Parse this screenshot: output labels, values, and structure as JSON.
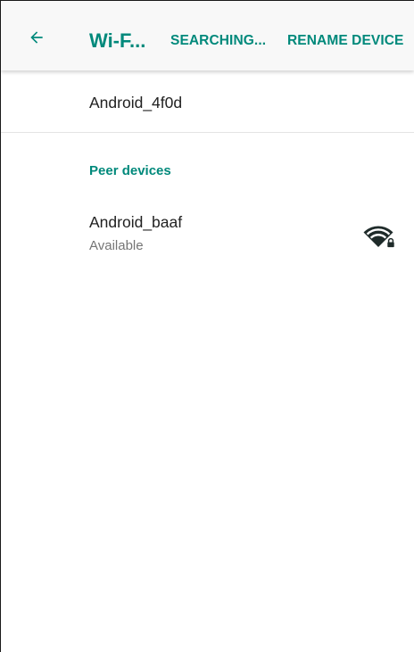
{
  "app_bar": {
    "title": "Wi-F...",
    "back_icon": "arrow-back-icon",
    "actions": {
      "searching": "SEARCHING...",
      "rename": "RENAME DEVICE"
    }
  },
  "device": {
    "name": "Android_4f0d"
  },
  "peers": {
    "header": "Peer devices",
    "items": [
      {
        "name": "Android_baaf",
        "status": "Available",
        "icon": "wifi-lock-icon"
      }
    ]
  },
  "colors": {
    "accent": "#00897b",
    "primary_text": "#212121",
    "secondary_text": "#757575",
    "icon": "#1f2b2a",
    "app_bar_bg": "#f8f8f8"
  }
}
